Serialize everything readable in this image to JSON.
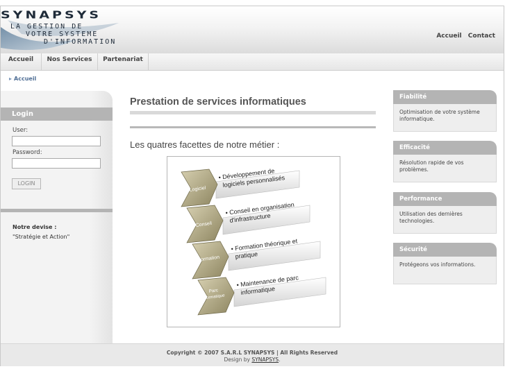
{
  "logo": {
    "title": "SYNAPSYS",
    "line1": "LA GESTION DE",
    "line2": "VOTRE SYSTEME",
    "line3": "D'INFORMATION"
  },
  "top_links": {
    "home": "Accueil",
    "contact": "Contact"
  },
  "nav": {
    "items": [
      "Accueil",
      "Nos Services",
      "Partenariat"
    ]
  },
  "breadcrumb": {
    "current": "Accueil"
  },
  "login": {
    "heading": "Login",
    "user_label": "User:",
    "password_label": "Password:",
    "button": "LOGIN"
  },
  "devise": {
    "title": "Notre devise :",
    "text": "\"Stratégie et Action\""
  },
  "main": {
    "title": "Prestation de services informatiques",
    "subtitle": "Les quatres facettes de notre métier :"
  },
  "diagram": {
    "steps": [
      {
        "tag": "Logiciel",
        "line1": "• Développement de",
        "line2": "logiciels personnalisés"
      },
      {
        "tag": "Conseil",
        "line1": "• Conseil en organisation",
        "line2": "d'infrastructure"
      },
      {
        "tag": "Formation",
        "line1": "• Formation théorique et",
        "line2": "pratique"
      },
      {
        "tag": "Parc",
        "tag2": "informatique",
        "line1": "• Maintenance de parc",
        "line2": "informatique"
      }
    ],
    "colors": {
      "chevron": "#c3bb97",
      "chevron_dark": "#8c845f",
      "banner": "#f2f2f2"
    }
  },
  "cards": [
    {
      "title": "Fiabilité",
      "body": "Optimisation de votre système informatique."
    },
    {
      "title": "Efficacité",
      "body": "Résolution rapide de vos problèmes."
    },
    {
      "title": "Performance",
      "body": "Utilisation des dernières technologies."
    },
    {
      "title": "Sécurité",
      "body": "Protégeons vos informations."
    }
  ],
  "footer": {
    "copyright": "Copyright © 2007 S.A.R.L SYNAPSYS | All Rights Reserved",
    "design_prefix": "Design by ",
    "design_link": "SYNAPSYS",
    "design_suffix": "."
  },
  "colors": {
    "accent_grey": "#b4b4b4",
    "link_blue": "#4f6e95"
  }
}
